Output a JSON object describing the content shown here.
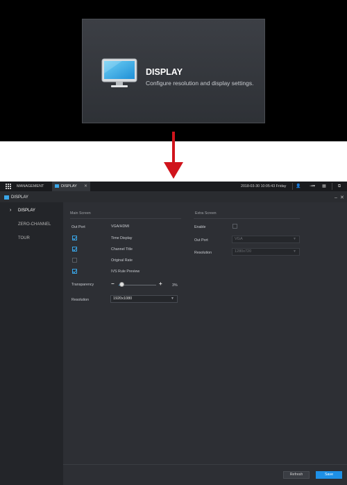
{
  "hero": {
    "title": "DISPLAY",
    "subtitle": "Configure resolution and display settings.",
    "icon": "monitor-icon"
  },
  "colors": {
    "accent": "#3aa6e8",
    "arrow": "#d0141c",
    "save": "#1e90e6"
  },
  "topbar": {
    "tabs": [
      {
        "label": "MANAGEMENT"
      },
      {
        "label": "DISPLAY"
      }
    ],
    "datetime": "2018-03-30 10:05:43 Friday"
  },
  "window": {
    "title": "DISPLAY"
  },
  "sidebar": {
    "items": [
      {
        "label": "DISPLAY"
      },
      {
        "label": "ZERO-CHANNEL"
      },
      {
        "label": "TOUR"
      }
    ]
  },
  "main_screen": {
    "title": "Main Screen",
    "out_port_label": "Out Port",
    "out_port_value": "VGA/HDMI",
    "options": [
      {
        "label": "Time Display",
        "checked": true
      },
      {
        "label": "Channel Title",
        "checked": true
      },
      {
        "label": "Original Rate",
        "checked": false
      },
      {
        "label": "IVS Rule Preview",
        "checked": true
      }
    ],
    "transparency_label": "Transparency",
    "transparency_value": "3%",
    "transparency_percent": 3,
    "resolution_label": "Resolution",
    "resolution_value": "1920x1080"
  },
  "extra_screen": {
    "title": "Extra Screen",
    "enable_label": "Enable",
    "enable_checked": false,
    "out_port_label": "Out Port",
    "out_port_value": "VGA",
    "resolution_label": "Resolution",
    "resolution_value": "1280x720"
  },
  "footer": {
    "refresh_label": "Refresh",
    "save_label": "Save"
  }
}
